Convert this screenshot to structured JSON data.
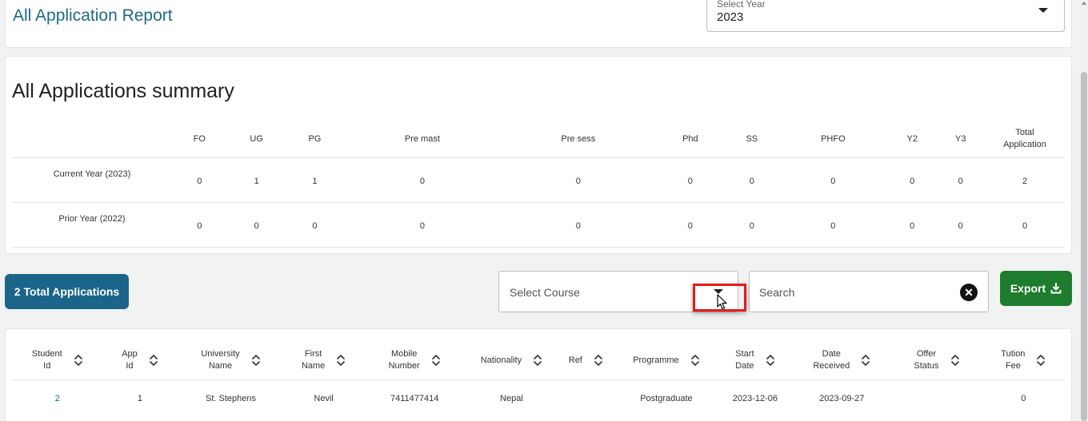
{
  "header": {
    "title": "All Application Report",
    "year_select": {
      "label": "Select Year",
      "value": "2023"
    }
  },
  "summary": {
    "title": "All Applications summary",
    "columns": [
      "",
      "FO",
      "UG",
      "PG",
      "Pre mast",
      "Pre sess",
      "Phd",
      "SS",
      "PHFO",
      "Y2",
      "Y3",
      "Total Application"
    ],
    "rows": [
      {
        "label": "Current Year (2023)",
        "values": [
          "0",
          "1",
          "1",
          "0",
          "0",
          "0",
          "0",
          "0",
          "0",
          "0",
          "2"
        ]
      },
      {
        "label": "Prior Year (2022)",
        "values": [
          "0",
          "0",
          "0",
          "0",
          "0",
          "0",
          "0",
          "0",
          "0",
          "0",
          "0"
        ]
      }
    ]
  },
  "controls": {
    "total_label": "2 Total Applications",
    "course_placeholder": "Select Course",
    "search_placeholder": "Search",
    "export_label": "Export"
  },
  "applications": {
    "columns": [
      [
        "Student",
        "Id"
      ],
      [
        "App",
        "Id"
      ],
      [
        "University",
        "Name"
      ],
      [
        "First",
        "Name"
      ],
      [
        "Mobile",
        "Number"
      ],
      [
        "Nationality"
      ],
      [
        "Ref"
      ],
      [
        "Programme"
      ],
      [
        "Start",
        "Date"
      ],
      [
        "Date",
        "Received"
      ],
      [
        "Offer",
        "Status"
      ],
      [
        "Tution",
        "Fee"
      ]
    ],
    "rows": [
      [
        "2",
        "1",
        "St. Stephens",
        "Nevil",
        "7411477414",
        "Nepal",
        "",
        "Postgraduate",
        "2023-12-06",
        "2023-09-27",
        "",
        "0"
      ]
    ]
  },
  "colors": {
    "title": "#1e6a8a",
    "primary_button": "#1a6589",
    "export_button": "#1e7c2e",
    "highlight": "#e41c1c"
  },
  "icons": {
    "year_dropdown": "caret-down-icon",
    "course_dropdown": "caret-down-icon",
    "clear_search": "close-circle-icon",
    "export": "download-icon",
    "sort": "sort-icon",
    "pointer": "mouse-cursor-icon"
  }
}
